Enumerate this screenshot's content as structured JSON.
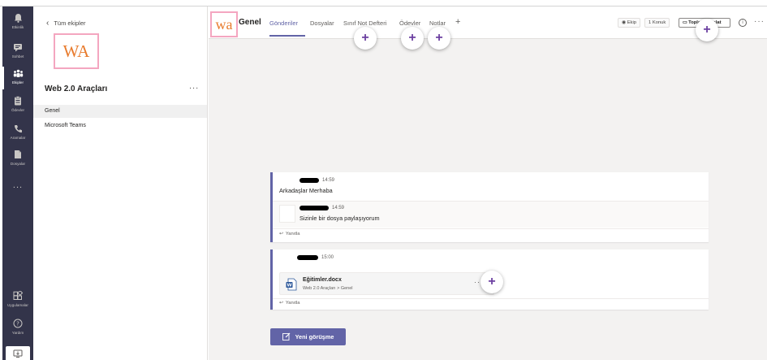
{
  "rail": {
    "items": [
      {
        "label": "Etkinlik",
        "icon": "bell-icon"
      },
      {
        "label": "Sohbet",
        "icon": "chat-icon"
      },
      {
        "label": "Ekipler",
        "icon": "teams-icon"
      },
      {
        "label": "Ödevler",
        "icon": "assignments-icon"
      },
      {
        "label": "Aramalar",
        "icon": "phone-icon"
      },
      {
        "label": "Dosyalar",
        "icon": "files-icon"
      }
    ],
    "more": "...",
    "apps_label": "Uygulamalar",
    "help_label": "Yardım"
  },
  "teampane": {
    "back_label": "Tüm ekipler",
    "avatar_text": "WA",
    "team_name": "Web 2.0 Araçları",
    "more": "...",
    "channels": [
      "Genel",
      "Microsoft Teams"
    ]
  },
  "header": {
    "avatar_text": "wa",
    "channel_name": "Genel",
    "tabs": [
      "Gönderiler",
      "Dosyalar",
      "Sınıf Not Defteri",
      "Ödevler",
      "Notlar"
    ],
    "add_tab": "+",
    "team_btn": "Ekip",
    "guest_btn": "1 Konuk",
    "meet_btn": "Toplantı başlat",
    "info": "i",
    "more": "···"
  },
  "plus": "+",
  "messages": {
    "m1": {
      "time": "14:59",
      "text": "Arkadaşlar Merhaba"
    },
    "m1_reply": {
      "time": "14:59",
      "text": "Sizinle bir dosya paylaşıyorum"
    },
    "m2": {
      "time": "15:00"
    },
    "file": {
      "name": "Eğitimler.docx",
      "path": "Web 2.0 Araçları > Genel",
      "more": "···"
    },
    "reply_label": "Yanıtla"
  },
  "new_conversation": "Yeni görüşme",
  "colors": {
    "rail": "#33344a",
    "accent": "#6264a7",
    "plus": "#6b3fa0"
  }
}
